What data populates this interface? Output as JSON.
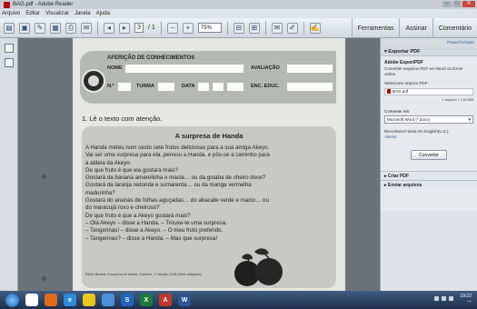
{
  "window": {
    "title": "BAG.pdf - Adobe Reader",
    "controls": [
      "–",
      "□",
      "✕"
    ]
  },
  "menu": [
    "Arquivo",
    "Editar",
    "Visualizar",
    "Janela",
    "Ajuda"
  ],
  "toolbar": {
    "page_current": "3",
    "page_total": "/ 1",
    "zoom": "75%",
    "tabs": [
      "Ferramentas",
      "Assinar",
      "Comentário"
    ]
  },
  "document": {
    "header_title": "AFERIÇÃO DE CONHECIMENTOS",
    "labels": {
      "nome": "NOME",
      "avaliacao": "AVALIAÇÃO",
      "numero": "N.º",
      "turma": "TURMA",
      "data": "DATA",
      "enc_educ": "ENC. EDUC."
    },
    "question": "1. Lê o texto com atenção.",
    "story_title": "A surpresa de Handa",
    "story_lines": [
      "A Handa meteu num cesto sete frutos deliciosas para a sua amiga Akeyo.",
      "Vai ser uma surpresa para ela, pensou a Handa, e pôs-se a caminho para",
      "a aldeia da Akeyo.",
      "De que fruto é que ela gostará mais?",
      "Gostará da banana amarelinha e macia… ou da goiaba de cheiro doce?",
      "Gostará da laranja redonda e sumarenta… ou da manga vermelha",
      "madurinha?",
      "Gostará do ananás de folhas aguçadas… do abacate verde e macio… ou",
      "do maracujá roxo e cheiroso?",
      "De que fruto é que a Akeyo gostará mais?",
      "– Olá Akeyo – disse a Handa. – Trouxe-te uma surpresa.",
      "– Tangerinas! – disse a Akeyo. – O meu fruto preferido.",
      "– Tangerinas? – disse a Handa. – Mas que surpresa!"
    ],
    "credit": "Eileen Browne, A surpresa de Handa, Caminho, 1.ª edição, 2018 (Texto adaptado)."
  },
  "right_pane": {
    "top_link": "Painel fechado",
    "section_title": "Exportar PDF",
    "export_title": "Adobe ExportPDF",
    "export_desc": "Converter arquivos PDF em Word ou Excel online.",
    "select_label": "Selecionar arquivo PDF:",
    "file_name": "BAG.pdf",
    "file_meta": "1 arquivo / 1.50 MB",
    "convert_label": "Converter em:",
    "convert_option": "Microsoft Word (*.docx)",
    "recognize_label": "Reconhecer texto em English(U.S.)",
    "change_link": "Alterar",
    "convert_button": "Converter",
    "create_pdf": "Criar PDF",
    "send_files": "Enviar arquivos"
  },
  "taskbar": {
    "apps": [
      "",
      "",
      "e",
      "",
      "",
      "S",
      "X",
      "A",
      "W"
    ],
    "app_colors": [
      "#ffffff",
      "#e06b1c",
      "#2d8bd8",
      "#f0c419",
      "#4a8fd8",
      "#2266bb",
      "#1e7a3c",
      "#c0392b",
      "#2f5597"
    ],
    "time": "19:22",
    "date": "—"
  }
}
